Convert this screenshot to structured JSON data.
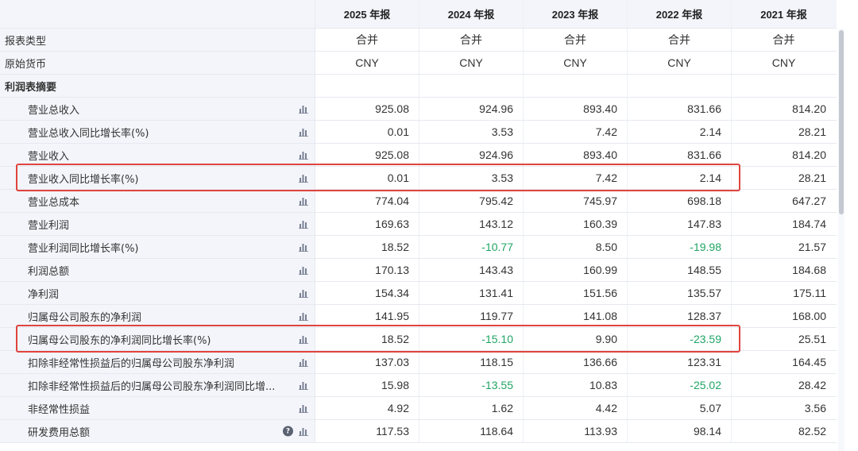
{
  "header": {
    "label": "",
    "years": [
      "2025 年报",
      "2024 年报",
      "2023 年报",
      "2022 年报",
      "2021 年报"
    ]
  },
  "meta_rows": [
    {
      "label": "报表类型",
      "values": [
        "合并",
        "合并",
        "合并",
        "合并",
        "合并"
      ]
    },
    {
      "label": "原始货币",
      "values": [
        "CNY",
        "CNY",
        "CNY",
        "CNY",
        "CNY"
      ]
    }
  ],
  "section": {
    "label": "利润表摘要"
  },
  "rows": [
    {
      "label": "营业总收入",
      "values": [
        "925.08",
        "924.96",
        "893.40",
        "831.66",
        "814.20"
      ],
      "highlighted": false
    },
    {
      "label": "营业总收入同比增长率(%)",
      "values": [
        "0.01",
        "3.53",
        "7.42",
        "2.14",
        "28.21"
      ],
      "highlighted": false
    },
    {
      "label": "营业收入",
      "values": [
        "925.08",
        "924.96",
        "893.40",
        "831.66",
        "814.20"
      ],
      "highlighted": false
    },
    {
      "label": "营业收入同比增长率(%)",
      "values": [
        "0.01",
        "3.53",
        "7.42",
        "2.14",
        "28.21"
      ],
      "highlighted": true
    },
    {
      "label": "营业总成本",
      "values": [
        "774.04",
        "795.42",
        "745.97",
        "698.18",
        "647.27"
      ],
      "highlighted": false
    },
    {
      "label": "营业利润",
      "values": [
        "169.63",
        "143.12",
        "160.39",
        "147.83",
        "184.74"
      ],
      "highlighted": false
    },
    {
      "label": "营业利润同比增长率(%)",
      "values": [
        "18.52",
        "-10.77",
        "8.50",
        "-19.98",
        "21.57"
      ],
      "highlighted": false
    },
    {
      "label": "利润总额",
      "values": [
        "170.13",
        "143.43",
        "160.99",
        "148.55",
        "184.68"
      ],
      "highlighted": false
    },
    {
      "label": "净利润",
      "values": [
        "154.34",
        "131.41",
        "151.56",
        "135.57",
        "175.11"
      ],
      "highlighted": false
    },
    {
      "label": "归属母公司股东的净利润",
      "values": [
        "141.95",
        "119.77",
        "141.08",
        "128.37",
        "168.00"
      ],
      "highlighted": false
    },
    {
      "label": "归属母公司股东的净利润同比增长率(%)",
      "values": [
        "18.52",
        "-15.10",
        "9.90",
        "-23.59",
        "25.51"
      ],
      "highlighted": true
    },
    {
      "label": "扣除非经常性损益后的归属母公司股东净利润",
      "values": [
        "137.03",
        "118.15",
        "136.66",
        "123.31",
        "164.45"
      ],
      "highlighted": false
    },
    {
      "label": "扣除非经常性损益后的归属母公司股东净利润同比增...",
      "values": [
        "15.98",
        "-13.55",
        "10.83",
        "-25.02",
        "28.42"
      ],
      "highlighted": false
    },
    {
      "label": "非经常性损益",
      "values": [
        "4.92",
        "1.62",
        "4.42",
        "5.07",
        "3.56"
      ],
      "highlighted": false
    },
    {
      "label": "研发费用总额",
      "values": [
        "117.53",
        "118.64",
        "113.93",
        "98.14",
        "82.52"
      ],
      "highlighted": false,
      "help": true
    }
  ],
  "icons": {
    "chart": "bar-chart-icon",
    "help": "help-icon",
    "help_glyph": "?"
  },
  "colors": {
    "negative": "#1fa563",
    "highlight_border": "#e0443e",
    "label_bg": "#f3f5fa",
    "chart_icon": "#7a8194"
  }
}
